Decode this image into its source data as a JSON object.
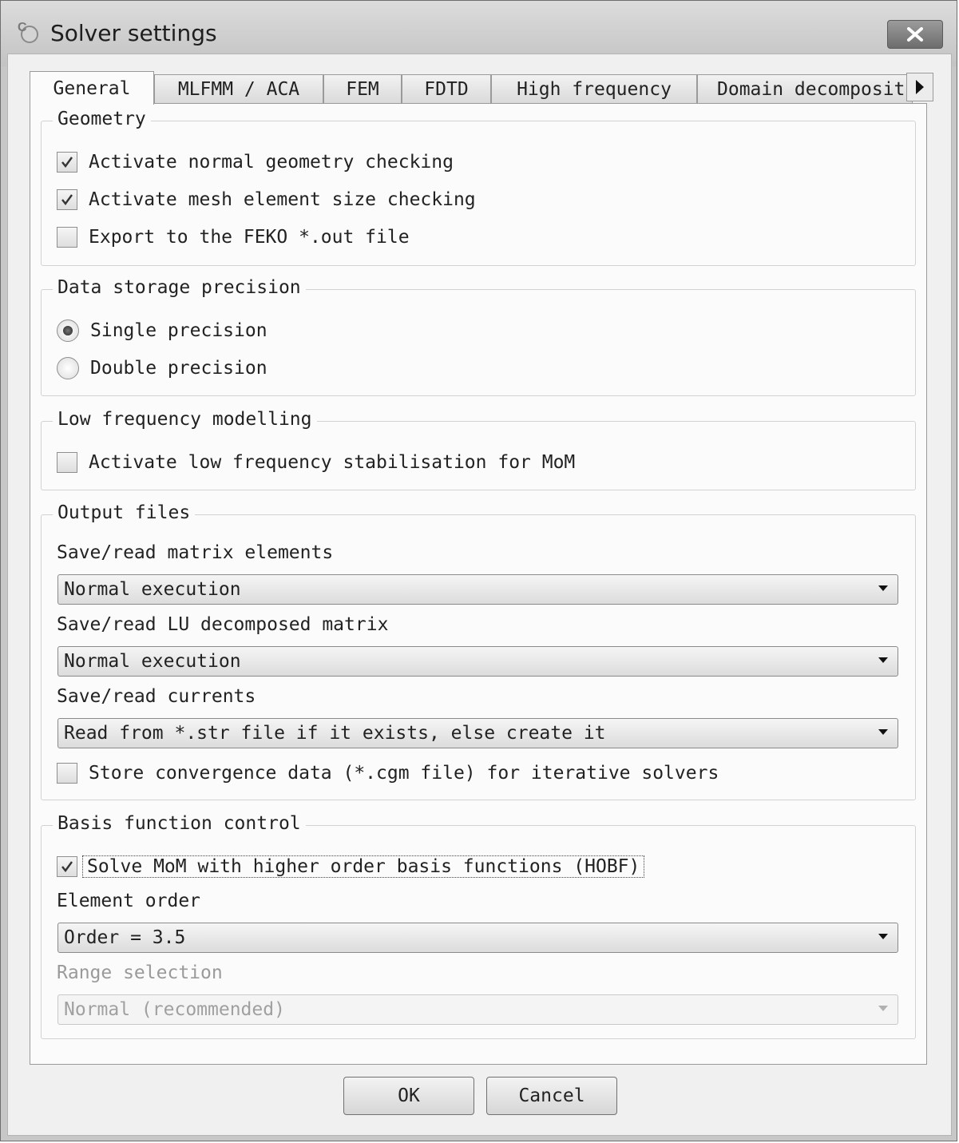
{
  "window": {
    "title": "Solver settings",
    "app_icon": "cadfeko-app-icon",
    "close_icon": "close-icon"
  },
  "tabs": [
    "General",
    "MLFMM / ACA",
    "FEM",
    "FDTD",
    "High frequency",
    "Domain decomposition"
  ],
  "active_tab": "General",
  "geometry": {
    "legend": "Geometry",
    "items": [
      {
        "label": "Activate normal geometry checking",
        "checked": true
      },
      {
        "label": "Activate mesh element size checking",
        "checked": true
      },
      {
        "label": "Export to the FEKO *.out file",
        "checked": false
      }
    ]
  },
  "precision": {
    "legend": "Data storage precision",
    "options": [
      {
        "label": "Single precision",
        "selected": true
      },
      {
        "label": "Double precision",
        "selected": false
      }
    ]
  },
  "low_freq": {
    "legend": "Low frequency modelling",
    "item": {
      "label": "Activate low frequency stabilisation for MoM",
      "checked": false
    }
  },
  "output": {
    "legend": "Output files",
    "matrix_label": "Save/read matrix elements",
    "matrix_value": "Normal execution",
    "lu_label": "Save/read LU decomposed matrix",
    "lu_value": "Normal execution",
    "currents_label": "Save/read currents",
    "currents_value": "Read from *.str file if it exists, else create it",
    "convergence": {
      "label": "Store convergence data (*.cgm file) for iterative solvers",
      "checked": false
    }
  },
  "basis": {
    "legend": "Basis function control",
    "hobf": {
      "label": "Solve MoM with higher order basis functions (HOBF)",
      "checked": true
    },
    "order_label": "Element order",
    "order_value": "Order = 3.5",
    "range_label": "Range selection",
    "range_value": "Normal (recommended)"
  },
  "buttons": {
    "ok": "OK",
    "cancel": "Cancel"
  }
}
